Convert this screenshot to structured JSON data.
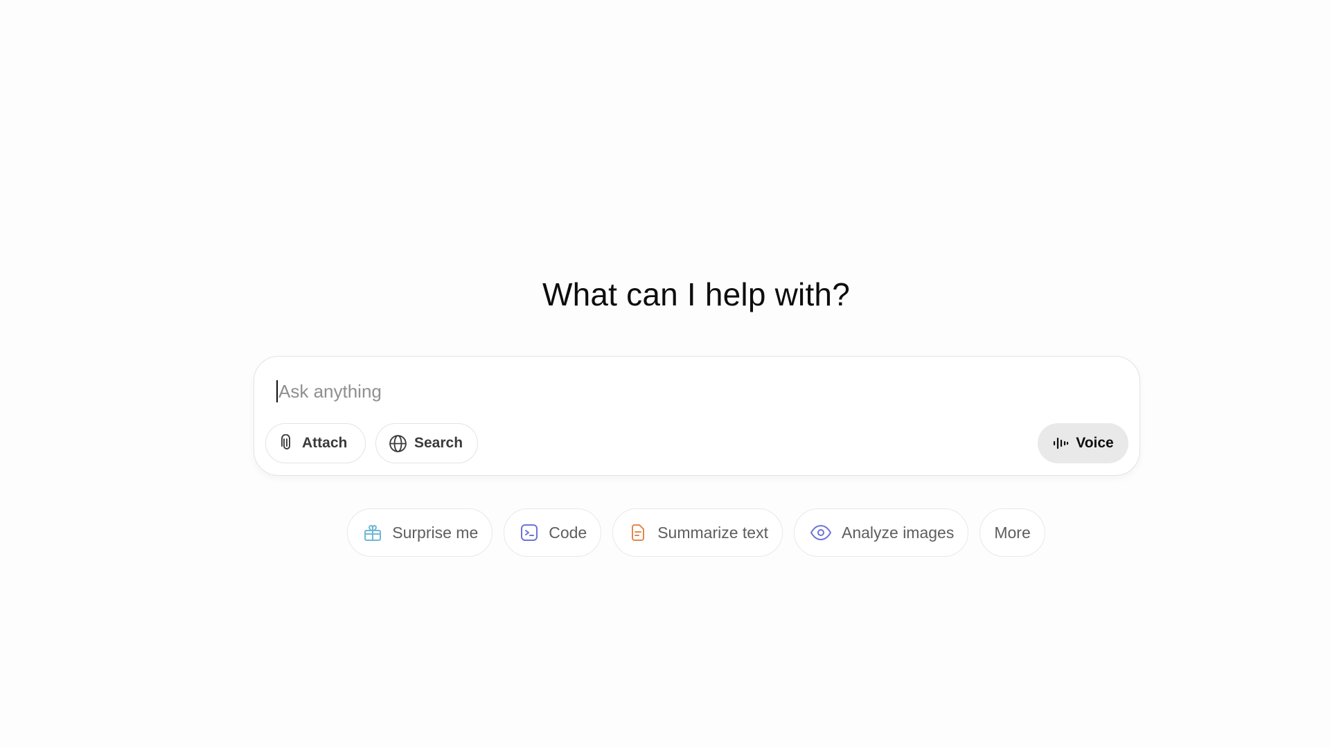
{
  "main": {
    "headline": "What can I help with?"
  },
  "composer": {
    "placeholder": "Ask anything",
    "value": "",
    "attach_label": "Attach",
    "search_label": "Search",
    "voice_label": "Voice"
  },
  "suggestions": [
    {
      "label": "Surprise me",
      "icon": "gift-icon",
      "color": "#6fb6d6"
    },
    {
      "label": "Code",
      "icon": "terminal-icon",
      "color": "#6c72d9"
    },
    {
      "label": "Summarize text",
      "icon": "document-icon",
      "color": "#e2874a"
    },
    {
      "label": "Analyze images",
      "icon": "eye-icon",
      "color": "#6c72d9"
    },
    {
      "label": "More",
      "icon": "",
      "color": ""
    }
  ]
}
